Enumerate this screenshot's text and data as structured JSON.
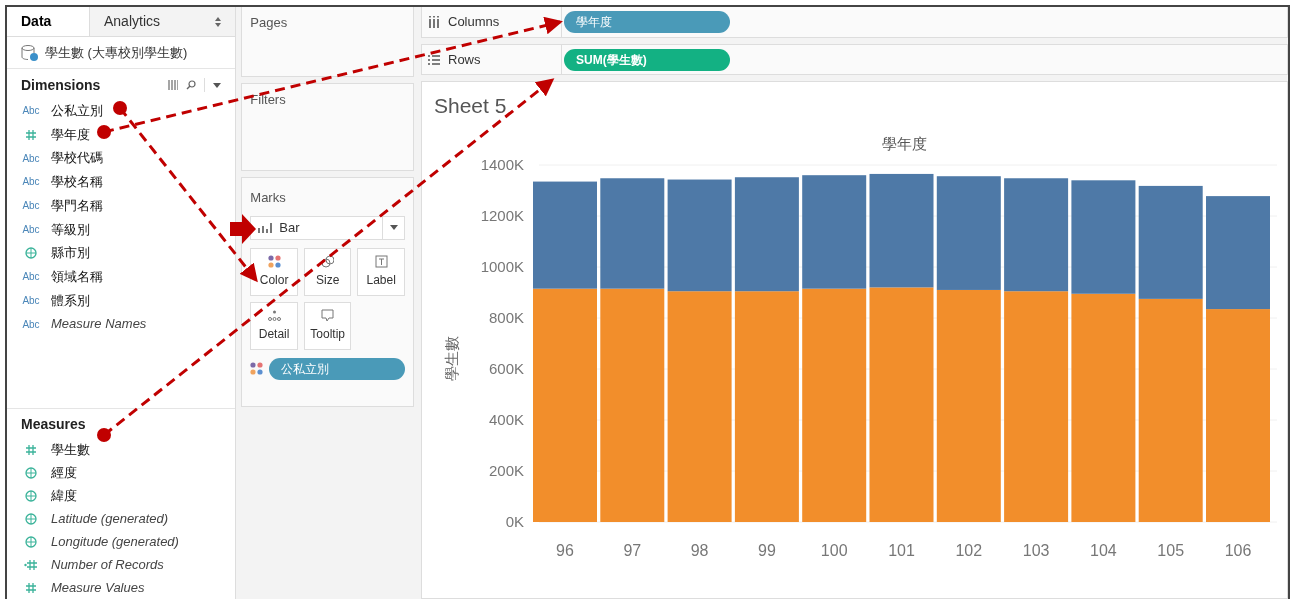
{
  "data_pane": {
    "tabs": [
      {
        "label": "Data",
        "selected": true
      },
      {
        "label": "Analytics",
        "selected": false
      }
    ],
    "data_source": "學生數 (大專校別學生數)",
    "dimensions": {
      "title": "Dimensions",
      "items": [
        {
          "label": "公私立別",
          "kind": "text",
          "type_label": "Abc",
          "generated": false
        },
        {
          "label": "學年度",
          "kind": "number",
          "generated": false
        },
        {
          "label": "學校代碼",
          "kind": "text",
          "type_label": "Abc",
          "generated": false
        },
        {
          "label": "學校名稱",
          "kind": "text",
          "type_label": "Abc",
          "generated": false
        },
        {
          "label": "學門名稱",
          "kind": "text",
          "type_label": "Abc",
          "generated": false
        },
        {
          "label": "等級別",
          "kind": "text",
          "type_label": "Abc",
          "generated": false
        },
        {
          "label": "縣市別",
          "kind": "geo",
          "generated": false
        },
        {
          "label": "領域名稱",
          "kind": "text",
          "type_label": "Abc",
          "generated": false
        },
        {
          "label": "體系別",
          "kind": "text",
          "type_label": "Abc",
          "generated": false
        },
        {
          "label": "Measure Names",
          "kind": "text",
          "type_label": "Abc",
          "generated": true
        }
      ]
    },
    "measures": {
      "title": "Measures",
      "items": [
        {
          "label": "學生數",
          "kind": "number",
          "generated": false
        },
        {
          "label": "經度",
          "kind": "geo",
          "generated": false
        },
        {
          "label": "緯度",
          "kind": "geo",
          "generated": false
        },
        {
          "label": "Latitude (generated)",
          "kind": "geo",
          "generated": true
        },
        {
          "label": "Longitude (generated)",
          "kind": "geo",
          "generated": true
        },
        {
          "label": "Number of Records",
          "kind": "calc",
          "generated": true
        },
        {
          "label": "Measure Values",
          "kind": "number",
          "generated": true
        }
      ]
    }
  },
  "cards": {
    "pages": "Pages",
    "filters": "Filters",
    "marks": {
      "title": "Marks",
      "mark_type": "Bar",
      "buttons": [
        {
          "label": "Color",
          "kind": "color"
        },
        {
          "label": "Size",
          "kind": "size"
        },
        {
          "label": "Label",
          "kind": "label"
        },
        {
          "label": "Detail",
          "kind": "detail"
        },
        {
          "label": "Tooltip",
          "kind": "tooltip"
        }
      ],
      "color_pill": "公私立別"
    }
  },
  "shelves": [
    {
      "label": "Columns",
      "kind": "columns",
      "pill": "學年度",
      "color": "#4a9ab8"
    },
    {
      "label": "Rows",
      "kind": "rows",
      "pill": "SUM(學生數)",
      "color": "#13b183"
    }
  ],
  "sheet": {
    "title": "Sheet 5",
    "chart_data": {
      "type": "bar",
      "stacked": true,
      "title": "學年度",
      "ylabel": "學生數",
      "categories": [
        "96",
        "97",
        "98",
        "99",
        "100",
        "101",
        "102",
        "103",
        "104",
        "105",
        "106"
      ],
      "series": [
        {
          "color": "#f28e2b",
          "values": [
            915,
            915,
            905,
            905,
            915,
            920,
            910,
            905,
            895,
            875,
            835
          ]
        },
        {
          "color": "#4e79a7",
          "values": [
            420,
            433,
            438,
            447,
            445,
            445,
            446,
            443,
            445,
            443,
            443
          ]
        }
      ],
      "ylim": [
        0,
        1400
      ],
      "grid": true,
      "yticks": [
        {
          "value": 0,
          "label": "0K"
        },
        {
          "value": 200,
          "label": "200K"
        },
        {
          "value": 400,
          "label": "400K"
        },
        {
          "value": 600,
          "label": "600K"
        },
        {
          "value": 800,
          "label": "800K"
        },
        {
          "value": 1000,
          "label": "1000K"
        },
        {
          "value": 1200,
          "label": "1200K"
        },
        {
          "value": 1400,
          "label": "1400K"
        }
      ]
    }
  }
}
